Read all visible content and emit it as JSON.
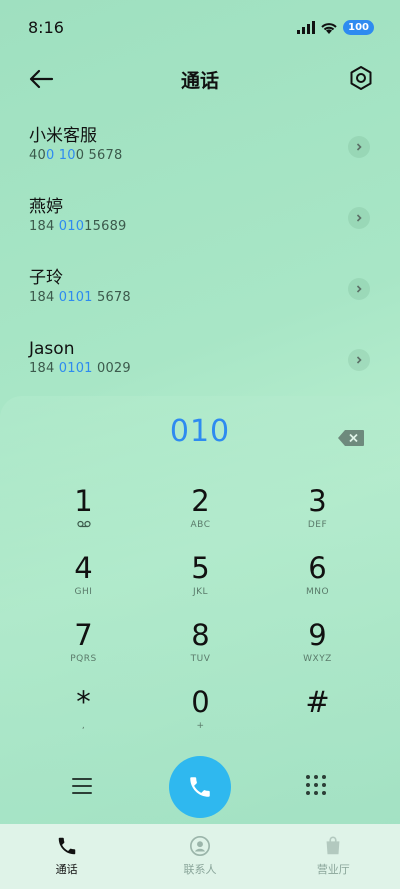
{
  "status_bar": {
    "time": "8:16",
    "battery": "100"
  },
  "header": {
    "title": "通话"
  },
  "contacts": [
    {
      "name": "小米客服",
      "number_parts": [
        "40",
        "0",
        " ",
        "10",
        "0 5678"
      ]
    },
    {
      "name": "燕婷",
      "number_parts": [
        "184 ",
        "010",
        "15689",
        "",
        ""
      ]
    },
    {
      "name": "子玲",
      "number_parts": [
        "184 ",
        "0101",
        " 5678",
        "",
        ""
      ]
    },
    {
      "name": "Jason",
      "number_parts": [
        "184 ",
        "0101",
        " 0029",
        "",
        ""
      ]
    }
  ],
  "dialpad": {
    "entry": "010",
    "keys": [
      {
        "digit": "1",
        "letters": ""
      },
      {
        "digit": "2",
        "letters": "ABC"
      },
      {
        "digit": "3",
        "letters": "DEF"
      },
      {
        "digit": "4",
        "letters": "GHI"
      },
      {
        "digit": "5",
        "letters": "JKL"
      },
      {
        "digit": "6",
        "letters": "MNO"
      },
      {
        "digit": "7",
        "letters": "PQRS"
      },
      {
        "digit": "8",
        "letters": "TUV"
      },
      {
        "digit": "9",
        "letters": "WXYZ"
      },
      {
        "digit": "*",
        "letters": ","
      },
      {
        "digit": "0",
        "letters": "+"
      },
      {
        "digit": "#",
        "letters": ""
      }
    ]
  },
  "bottom_nav": {
    "items": [
      {
        "label": "通话",
        "icon": "phone-icon",
        "active": true
      },
      {
        "label": "联系人",
        "icon": "contacts-icon",
        "active": false
      },
      {
        "label": "营业厅",
        "icon": "store-icon",
        "active": false
      }
    ]
  },
  "colors": {
    "accent": "#2e8bf0",
    "call_button": "#2fb8ef"
  }
}
